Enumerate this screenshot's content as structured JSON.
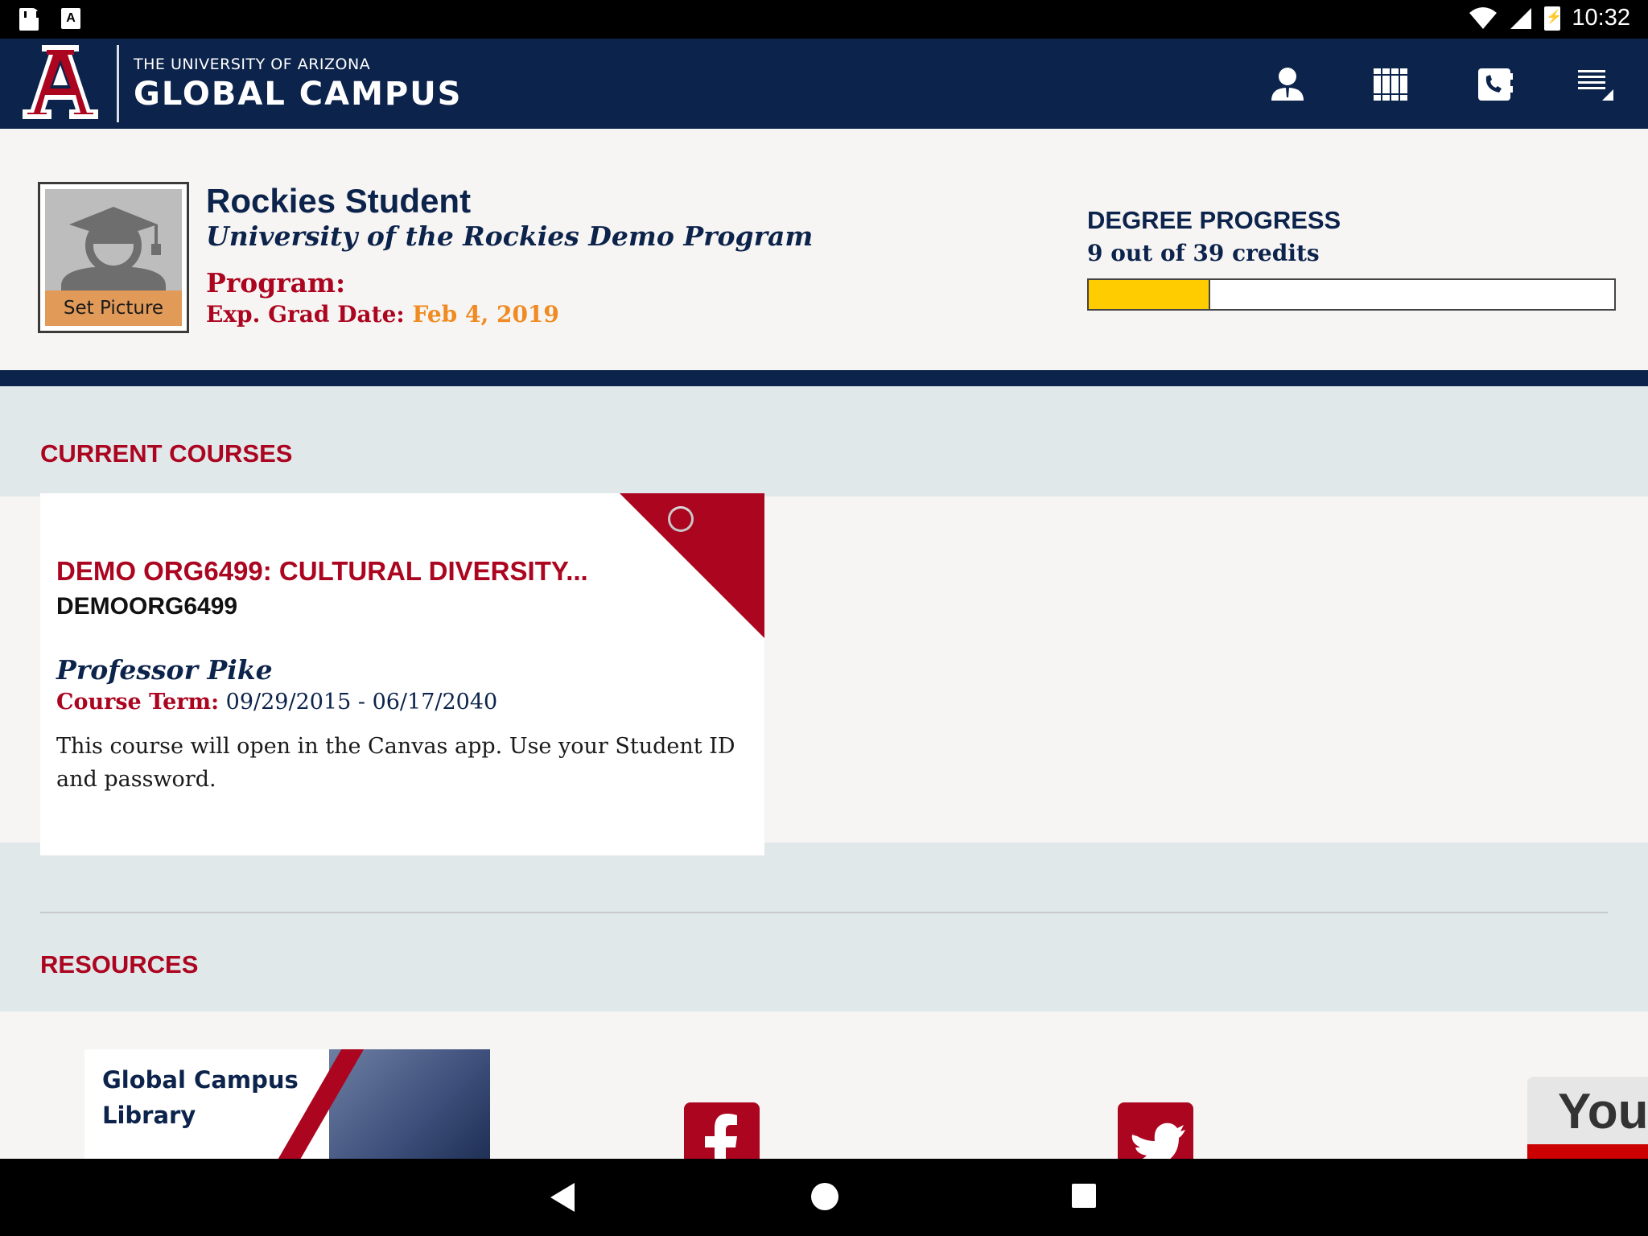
{
  "status_bar": {
    "time": "10:32",
    "left_icons": [
      "sd-card-icon",
      "accessibility-a-icon"
    ],
    "right_icons": [
      "wifi-icon",
      "cell-signal-icon",
      "battery-charging-icon"
    ]
  },
  "header": {
    "logo_small": "THE UNIVERSITY OF ARIZONA",
    "logo_big": "GLOBAL CAMPUS",
    "nav_icons": [
      "profile-icon",
      "library-books-icon",
      "contact-phone-icon",
      "menu-icon"
    ],
    "colors": {
      "navy": "#0c234b",
      "red": "#ab0520"
    }
  },
  "profile": {
    "set_picture": "Set Picture",
    "name": "Rockies Student",
    "program_name": "University of the Rockies Demo Program",
    "program_label": "Program:",
    "grad_label": "Exp. Grad Date:",
    "grad_value": "Feb 4, 2019"
  },
  "degree_progress": {
    "title": "DEGREE PROGRESS",
    "credits_text": "9 out of 39 credits",
    "credits_earned": 9,
    "credits_total": 39,
    "bar_color": "#ffcc00"
  },
  "current_courses": {
    "title": "CURRENT COURSES",
    "courses": [
      {
        "title": "DEMO ORG6499: CULTURAL DIVERSITY...",
        "code": "DEMOORG6499",
        "professor": "Professor Pike",
        "term_label": "Course Term:",
        "term_value": "09/29/2015 - 06/17/2040",
        "note": "This course will open in the Canvas app. Use your Student ID and password."
      }
    ]
  },
  "resources": {
    "title": "RESOURCES",
    "library_label": "Global Campus Library",
    "social_icons": [
      "facebook-icon",
      "twitter-icon"
    ],
    "youtube_text": "You"
  },
  "nav_bar": {
    "buttons": [
      "back-button",
      "home-button",
      "recents-button"
    ]
  }
}
